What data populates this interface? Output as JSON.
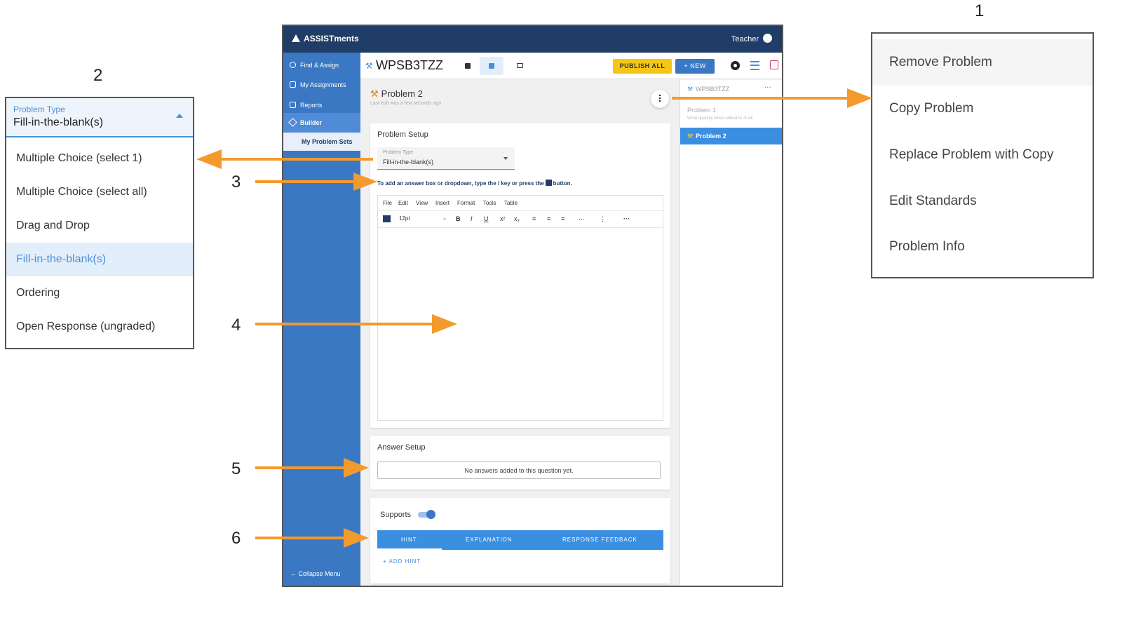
{
  "callouts": [
    "1",
    "2",
    "3",
    "4",
    "5",
    "6"
  ],
  "dropdown": {
    "label": "Problem Type",
    "value": "Fill-in-the-blank(s)",
    "options": [
      "Multiple Choice (select 1)",
      "Multiple Choice (select all)",
      "Drag and Drop",
      "Fill-in-the-blank(s)",
      "Ordering",
      "Open Response (ungraded)"
    ],
    "selected_index": 3
  },
  "context_menu": {
    "items": [
      "Remove Problem",
      "Copy Problem",
      "Replace Problem with Copy",
      "Edit Standards",
      "Problem Info"
    ]
  },
  "app": {
    "logo": "ASSISTments",
    "user": "Teacher",
    "nav": {
      "items": [
        "Find & Assign",
        "My Assignments",
        "Reports",
        "Builder"
      ],
      "sub_item": "My Problem Sets",
      "collapse": "Collapse Menu"
    },
    "header": {
      "title": "WPSB3TZZ",
      "publish_label": "PUBLISH ALL",
      "new_label": "+ NEW"
    },
    "problem": {
      "title": "Problem 2",
      "subtitle": "Last edit was a few seconds ago"
    },
    "problem_setup": {
      "heading": "Problem Setup",
      "type_label": "Problem Type",
      "type_value": "Fill-in-the-blank(s)",
      "hint_prefix": "To add an answer box or dropdown, type the / key or press the",
      "hint_suffix": "button.",
      "editor_menu": [
        "File",
        "Edit",
        "View",
        "Insert",
        "Format",
        "Tools",
        "Table"
      ],
      "font_size": "12pt"
    },
    "answer_setup": {
      "heading": "Answer Setup",
      "empty_text": "No answers added to this question yet."
    },
    "supports": {
      "label": "Supports",
      "tabs": [
        "HINT",
        "EXPLANATION",
        "RESPONSE FEEDBACK"
      ],
      "add_hint": "+ ADD HINT"
    },
    "problem_list": {
      "set_name": "WPSB3TZZ",
      "items": [
        {
          "name": "Problem 1",
          "preview": "What quantity when added to -8 wil"
        },
        {
          "name": "Problem 2"
        }
      ],
      "selected_index": 1
    }
  },
  "colors": {
    "arrow": "#f39a2c",
    "nav_blue": "#3b78c3",
    "topbar": "#1f3d66",
    "publish_yellow": "#f5c518",
    "accent": "#4a90d9"
  }
}
